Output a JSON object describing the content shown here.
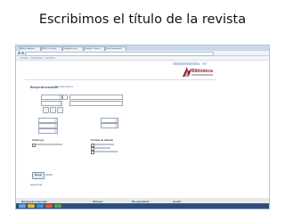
{
  "slide": {
    "title": "Escribimos el título de la revista"
  },
  "browser": {
    "tabs": [
      "Biblio | Búsqueda...",
      "EBSCO Discovery",
      "Catálogo en línea",
      "Catálogo - Revistas",
      "Portal de búsqueda"
    ]
  },
  "site": {
    "logo_text": "Biblioteca",
    "search_heading": "Búsqueda avanzada",
    "search_heading_link": "Búsqueda básica",
    "limit_label": "Limitar por",
    "format_label": "Formato de material",
    "search_button": "Buscar",
    "feedback_text": "Sugerencias",
    "footer_columns": [
      "Búsqueda avanzada",
      "Obtener",
      "Mi expediente",
      "Ayuda"
    ]
  },
  "colors": {
    "logo": "#8c1c2c",
    "taskbar": "#2c4f7c",
    "accent": "#3c5a80"
  }
}
